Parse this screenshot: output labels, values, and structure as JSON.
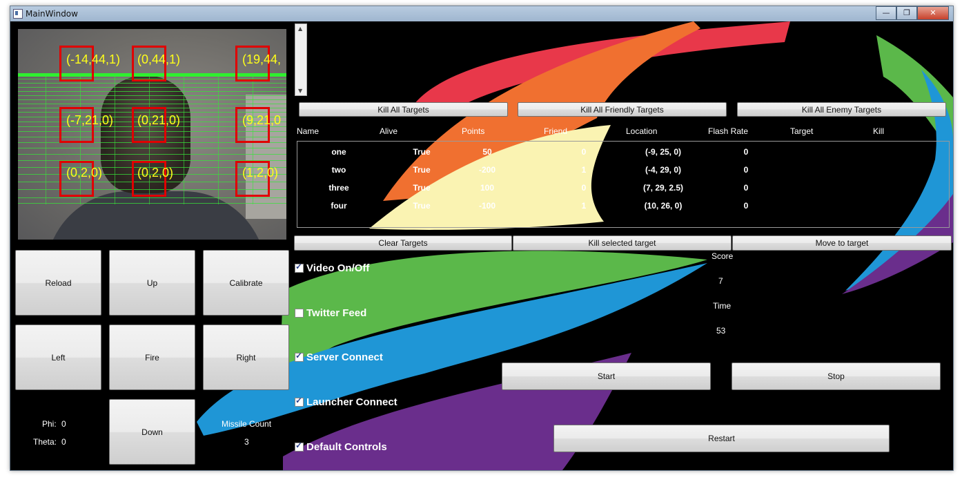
{
  "window": {
    "title": "MainWindow",
    "controls": {
      "minimize": "—",
      "maximize": "❐",
      "close": "✕"
    }
  },
  "video": {
    "labels": [
      "(-14,44,1)",
      "(0,44,1)",
      "(19,44,",
      "(-7,21,0)",
      "(0,21,0)",
      "(9,21,0",
      "(0,2,0)",
      "(0,2,0)",
      "(1,2,0)"
    ]
  },
  "controls": {
    "reload": "Reload",
    "up": "Up",
    "calibrate": "Calibrate",
    "left": "Left",
    "fire": "Fire",
    "right": "Right",
    "down": "Down"
  },
  "status": {
    "phi_label": "Phi:",
    "phi_value": "0",
    "theta_label": "Theta:",
    "theta_value": "0",
    "missile_label": "Missile Count",
    "missile_value": "3"
  },
  "toolbar": {
    "kill_all": "Kill All Targets",
    "kill_friendly": "Kill All Friendly Targets",
    "kill_enemy": "Kill All Enemy Targets"
  },
  "table": {
    "columns": [
      "Name",
      "Alive",
      "Points",
      "Friend",
      "Location",
      "Flash Rate",
      "Target",
      "Kill"
    ],
    "rows": [
      {
        "name": "one",
        "alive": "True",
        "points": "50",
        "friend": "0",
        "location": "(-9, 25, 0)",
        "flash": "0"
      },
      {
        "name": "two",
        "alive": "True",
        "points": "-200",
        "friend": "1",
        "location": "(-4, 29, 0)",
        "flash": "0"
      },
      {
        "name": "three",
        "alive": "True",
        "points": "100",
        "friend": "0",
        "location": "(7, 29, 2.5)",
        "flash": "0"
      },
      {
        "name": "four",
        "alive": "True",
        "points": "-100",
        "friend": "1",
        "location": "(10, 26, 0)",
        "flash": "0"
      }
    ]
  },
  "actions": {
    "clear": "Clear Targets",
    "kill_selected": "Kill selected target",
    "move": "Move to target"
  },
  "checkboxes": [
    {
      "label": "Video On/Off",
      "checked": true
    },
    {
      "label": "Twitter Feed",
      "checked": false
    },
    {
      "label": "Server Connect",
      "checked": true
    },
    {
      "label": "Launcher Connect",
      "checked": true
    },
    {
      "label": "Default Controls",
      "checked": true
    }
  ],
  "game": {
    "score_label": "Score",
    "score": "7",
    "time_label": "Time",
    "time": "53",
    "start": "Start",
    "stop": "Stop",
    "restart": "Restart"
  },
  "colors": {
    "red": "#e8384a",
    "orange": "#f07030",
    "yellow": "#faf3b2",
    "green": "#5bb84a",
    "blue": "#1f96d6",
    "purple": "#6a2e8c"
  }
}
